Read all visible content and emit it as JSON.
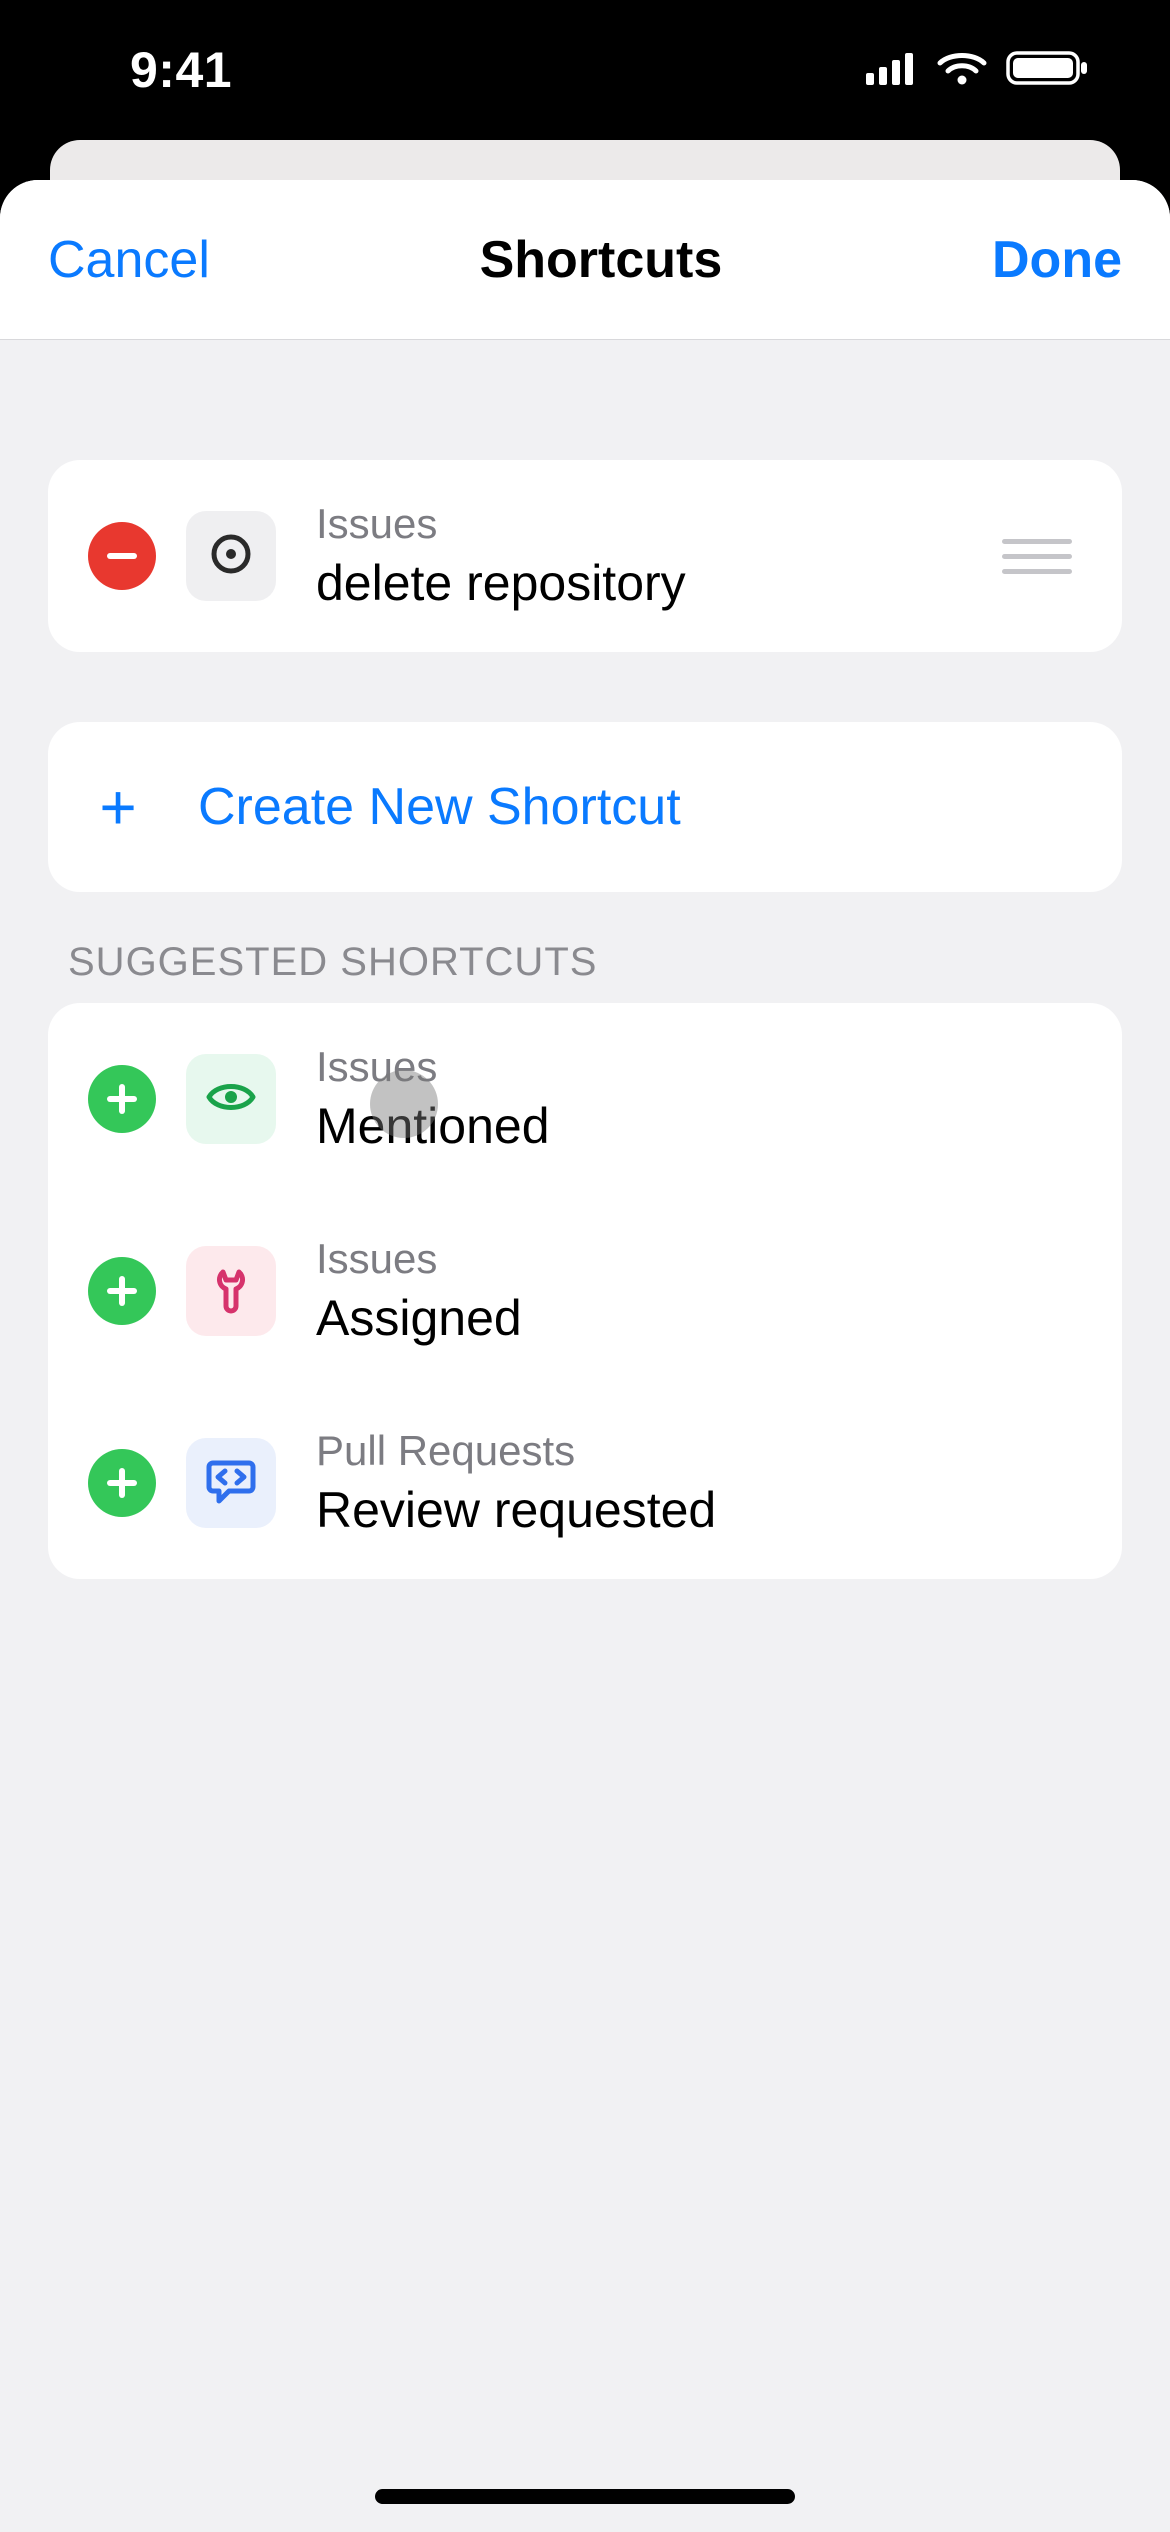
{
  "status": {
    "time": "9:41"
  },
  "nav": {
    "cancel": "Cancel",
    "title": "Shortcuts",
    "done": "Done"
  },
  "current_shortcuts": [
    {
      "category": "Issues",
      "title": "delete repository",
      "icon": "issue-opened"
    }
  ],
  "create": {
    "label": "Create New Shortcut"
  },
  "suggested_header": "SUGGESTED SHORTCUTS",
  "suggested": [
    {
      "category": "Issues",
      "title": "Mentioned",
      "icon": "eye",
      "tint": "green"
    },
    {
      "category": "Issues",
      "title": "Assigned",
      "icon": "tools",
      "tint": "pink"
    },
    {
      "category": "Pull Requests",
      "title": "Review requested",
      "icon": "code-review",
      "tint": "blue"
    }
  ]
}
